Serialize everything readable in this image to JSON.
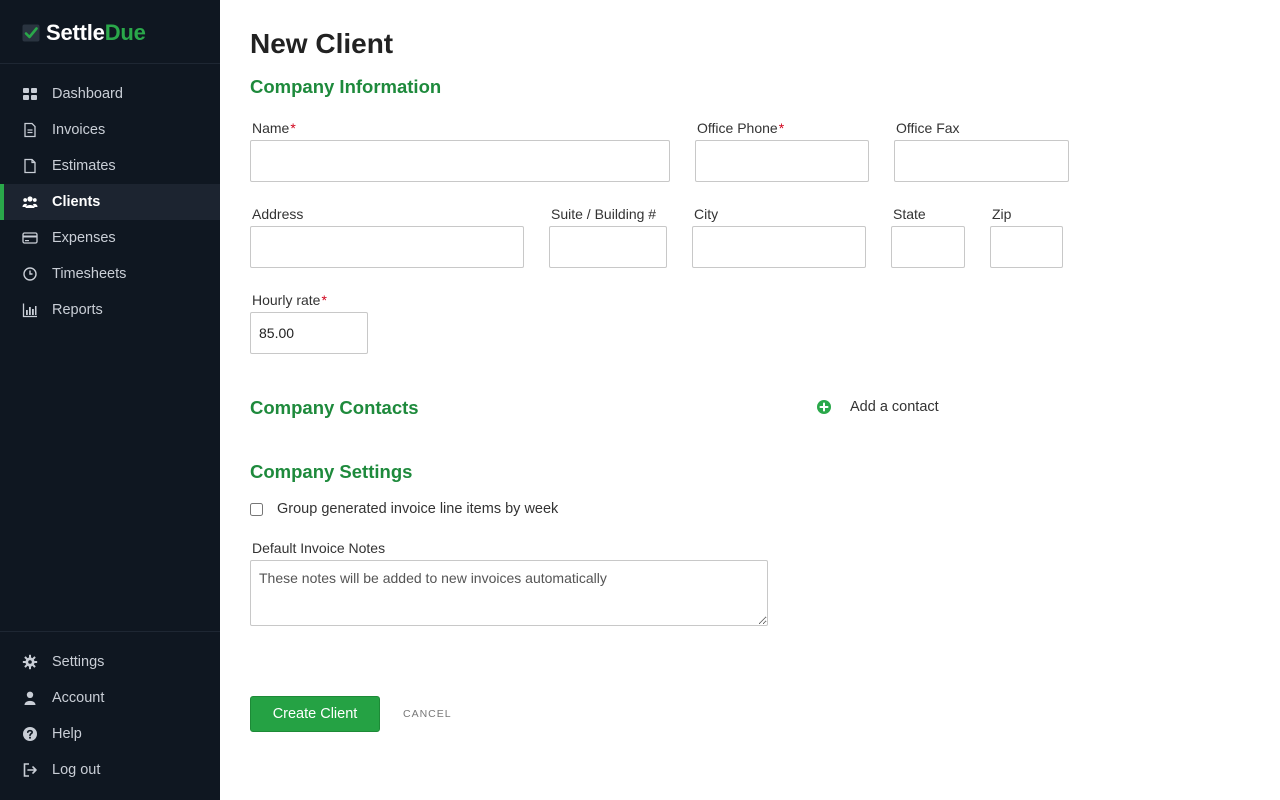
{
  "brand": {
    "name_part1": "Settle",
    "name_part2": "Due",
    "accent_color": "#2aa84a",
    "sidebar_bg": "#0f1721"
  },
  "nav": {
    "items": [
      {
        "label": "Dashboard",
        "icon": "dashboard-icon"
      },
      {
        "label": "Invoices",
        "icon": "invoice-icon"
      },
      {
        "label": "Estimates",
        "icon": "estimate-icon"
      },
      {
        "label": "Clients",
        "icon": "users-icon",
        "active": true
      },
      {
        "label": "Expenses",
        "icon": "credit-card-icon"
      },
      {
        "label": "Timesheets",
        "icon": "clock-icon"
      },
      {
        "label": "Reports",
        "icon": "bar-chart-icon"
      }
    ],
    "bottom": [
      {
        "label": "Settings",
        "icon": "gear-icon"
      },
      {
        "label": "Account",
        "icon": "user-icon"
      },
      {
        "label": "Help",
        "icon": "help-icon"
      },
      {
        "label": "Log out",
        "icon": "logout-icon"
      }
    ]
  },
  "page": {
    "title": "New Client"
  },
  "sections": {
    "company_info": "Company Information",
    "contacts": "Company Contacts",
    "settings": "Company Settings"
  },
  "fields": {
    "name": {
      "label": "Name",
      "value": ""
    },
    "office_phone": {
      "label": "Office Phone",
      "value": ""
    },
    "office_fax": {
      "label": "Office Fax",
      "value": ""
    },
    "address": {
      "label": "Address",
      "value": ""
    },
    "suite": {
      "label": "Suite / Building #",
      "value": ""
    },
    "city": {
      "label": "City",
      "value": ""
    },
    "state": {
      "label": "State",
      "value": ""
    },
    "zip": {
      "label": "Zip",
      "value": ""
    },
    "hourly_rate": {
      "label": "Hourly rate",
      "value": "85.00"
    },
    "required_mark": "*"
  },
  "contacts": {
    "add_label": "Add a contact"
  },
  "settings": {
    "group_by_week_label": "Group generated invoice line items by week",
    "group_by_week_checked": false,
    "notes_label": "Default Invoice Notes",
    "notes_placeholder": "These notes will be added to new invoices automatically"
  },
  "actions": {
    "create_label": "Create Client",
    "cancel_label": "CANCEL"
  }
}
